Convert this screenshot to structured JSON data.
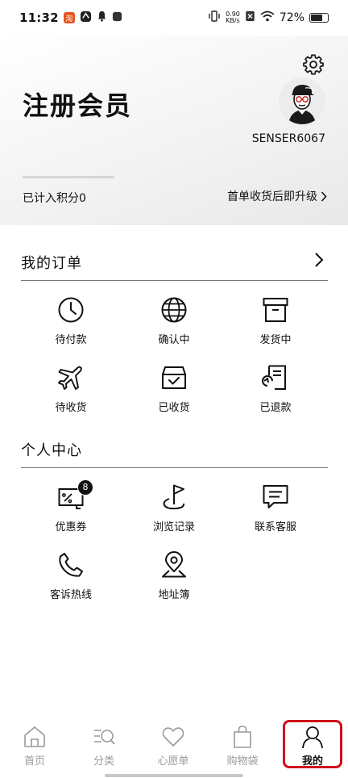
{
  "status_bar": {
    "time": "11:32",
    "net_speed_value": "0.90",
    "net_speed_unit": "KB/s",
    "battery": "72%",
    "battery_level": 0.72
  },
  "profile": {
    "title": "注册会员",
    "username": "SENSER6067",
    "points_label": "已计入积分0",
    "upgrade_label": "首单收货后即升级",
    "points_progress": 0
  },
  "orders": {
    "title": "我的订单",
    "items": [
      {
        "label": "待付款",
        "icon": "clock-icon"
      },
      {
        "label": "确认中",
        "icon": "globe-icon"
      },
      {
        "label": "发货中",
        "icon": "box-icon"
      },
      {
        "label": "待收货",
        "icon": "airplane-icon"
      },
      {
        "label": "已收货",
        "icon": "received-box-icon"
      },
      {
        "label": "已退款",
        "icon": "refund-icon"
      }
    ]
  },
  "personal": {
    "title": "个人中心",
    "items": [
      {
        "label": "优惠券",
        "icon": "coupon-icon",
        "badge": "8"
      },
      {
        "label": "浏览记录",
        "icon": "flag-icon"
      },
      {
        "label": "联系客服",
        "icon": "message-icon"
      },
      {
        "label": "客诉热线",
        "icon": "phone-icon"
      },
      {
        "label": "地址簿",
        "icon": "location-pin-icon"
      }
    ]
  },
  "bottom_nav": {
    "items": [
      {
        "label": "首页",
        "icon": "home-icon"
      },
      {
        "label": "分类",
        "icon": "category-search-icon"
      },
      {
        "label": "心愿单",
        "icon": "heart-icon"
      },
      {
        "label": "购物袋",
        "icon": "shopping-bag-icon"
      },
      {
        "label": "我的",
        "icon": "user-icon",
        "active": true
      }
    ]
  },
  "colors": {
    "active_highlight": "#d0101a",
    "text_primary": "#111111",
    "nav_inactive": "#9a9a9a"
  }
}
